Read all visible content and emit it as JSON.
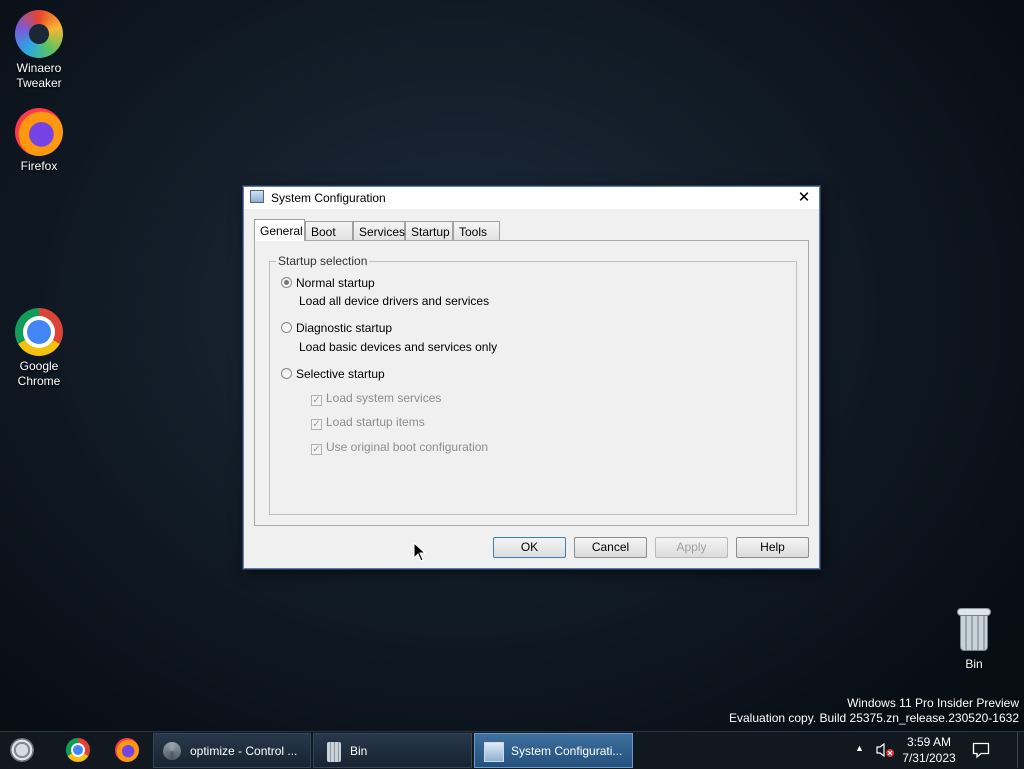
{
  "desktop": {
    "icons": [
      {
        "label_line1": "Winaero",
        "label_line2": "Tweaker"
      },
      {
        "label_line1": "Firefox",
        "label_line2": ""
      },
      {
        "label_line1": "Google",
        "label_line2": "Chrome"
      },
      {
        "label_line1": "Bin",
        "label_line2": ""
      }
    ],
    "watermark": {
      "line1": "Windows 11 Pro Insider Preview",
      "line2": "Evaluation copy. Build 25375.zn_release.230520-1632"
    }
  },
  "window": {
    "title": "System Configuration",
    "close_glyph": "✕",
    "tabs": [
      "General",
      "Boot",
      "Services",
      "Startup",
      "Tools"
    ],
    "active_tab": "General",
    "group_label": "Startup selection",
    "options": [
      {
        "label": "Normal startup",
        "description": "Load all device drivers and services",
        "checked": true
      },
      {
        "label": "Diagnostic startup",
        "description": "Load basic devices and services only",
        "checked": false
      },
      {
        "label": "Selective startup",
        "description": "",
        "checked": false
      }
    ],
    "selective_items": [
      {
        "label": "Load system services",
        "checked": true,
        "enabled": false
      },
      {
        "label": "Load startup items",
        "checked": true,
        "enabled": false
      },
      {
        "label": "Use original boot configuration",
        "checked": true,
        "enabled": false
      }
    ],
    "buttons": {
      "ok": "OK",
      "cancel": "Cancel",
      "apply": "Apply",
      "help": "Help"
    }
  },
  "taskbar": {
    "tasks": [
      {
        "label": "optimize - Control ..."
      },
      {
        "label": "Bin"
      },
      {
        "label": "System Configurati..."
      }
    ],
    "clock": {
      "time": "3:59 AM",
      "date": "7/31/2023"
    },
    "tray_overflow_glyph": "▲"
  },
  "colors": {
    "accent": "#3c7fb1",
    "taskbar_bg": "#121820",
    "active_task": "#2f6296"
  }
}
